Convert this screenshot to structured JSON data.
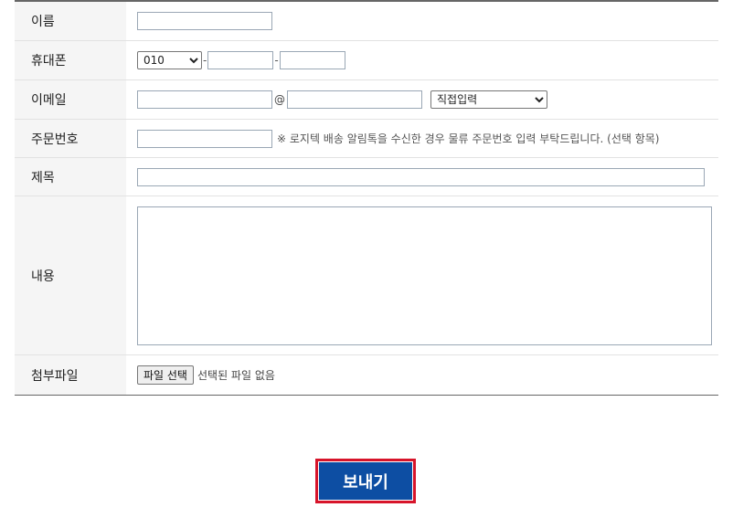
{
  "form": {
    "name": {
      "label": "이름",
      "value": ""
    },
    "phone": {
      "label": "휴대폰",
      "prefix_selected": "010",
      "separator": "-",
      "mid": "",
      "last": ""
    },
    "email": {
      "label": "이메일",
      "local": "",
      "at": "@",
      "domain": "",
      "domain_select": "직접입력"
    },
    "order": {
      "label": "주문번호",
      "value": "",
      "note": "※ 로지텍 배송 알림톡을 수신한 경우 물류 주문번호 입력 부탁드립니다. (선택 항목)"
    },
    "subject": {
      "label": "제목",
      "value": ""
    },
    "content": {
      "label": "내용",
      "value": ""
    },
    "attachment": {
      "label": "첨부파일",
      "button": "파일 선택",
      "status": "선택된 파일 없음"
    }
  },
  "submit": {
    "label": "보내기"
  },
  "colors": {
    "submit_bg": "#0d4ea3",
    "submit_outline": "#d7142a"
  }
}
